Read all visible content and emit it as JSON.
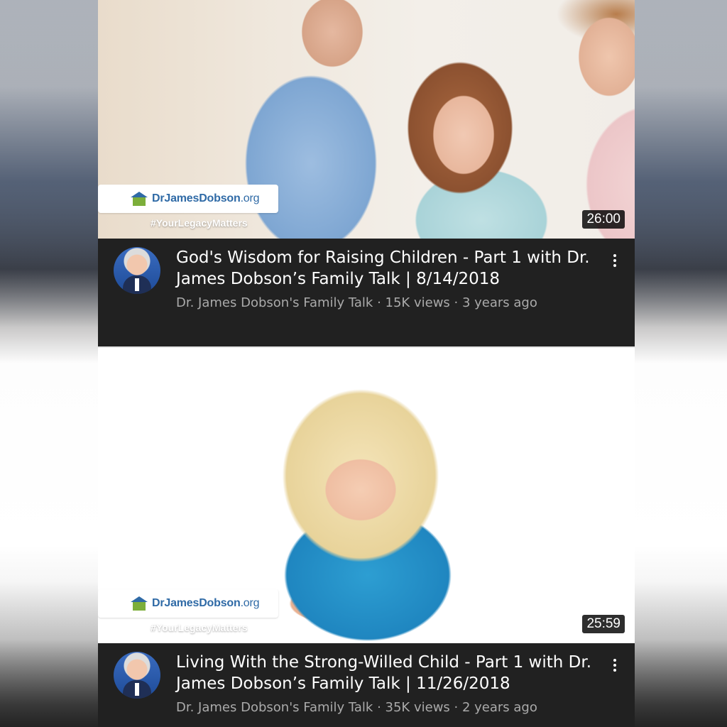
{
  "videos": [
    {
      "title": "God's Wisdom for Raising Children  - Part 1 with Dr. James Dobson’s Family Talk | 8/14/2018",
      "channel": "Dr. James Dobson's Family Talk",
      "views": "15K views",
      "age": "3 years ago",
      "separator": " · ",
      "duration": "26:00",
      "logo_text": "DrJamesDobson",
      "logo_suffix": ".org",
      "hashtag": "#YourLegacyMatters"
    },
    {
      "title": "Living With the Strong-Willed Child - Part 1 with Dr. James Dobson’s Family Talk | 11/26/2018",
      "channel": "Dr. James Dobson's Family Talk",
      "views": "35K views",
      "age": "2 years ago",
      "separator": " · ",
      "duration": "25:59",
      "logo_text": "DrJamesDobson",
      "logo_suffix": ".org",
      "hashtag": "#YourLegacyMatters"
    }
  ],
  "colors": {
    "card_background": "#212121",
    "subline": "#aaaaaa",
    "logo_blue": "#2f6aa6",
    "logo_green": "#7cae3a"
  },
  "icons": [
    "more-vert-icon",
    "house-logo-icon"
  ]
}
